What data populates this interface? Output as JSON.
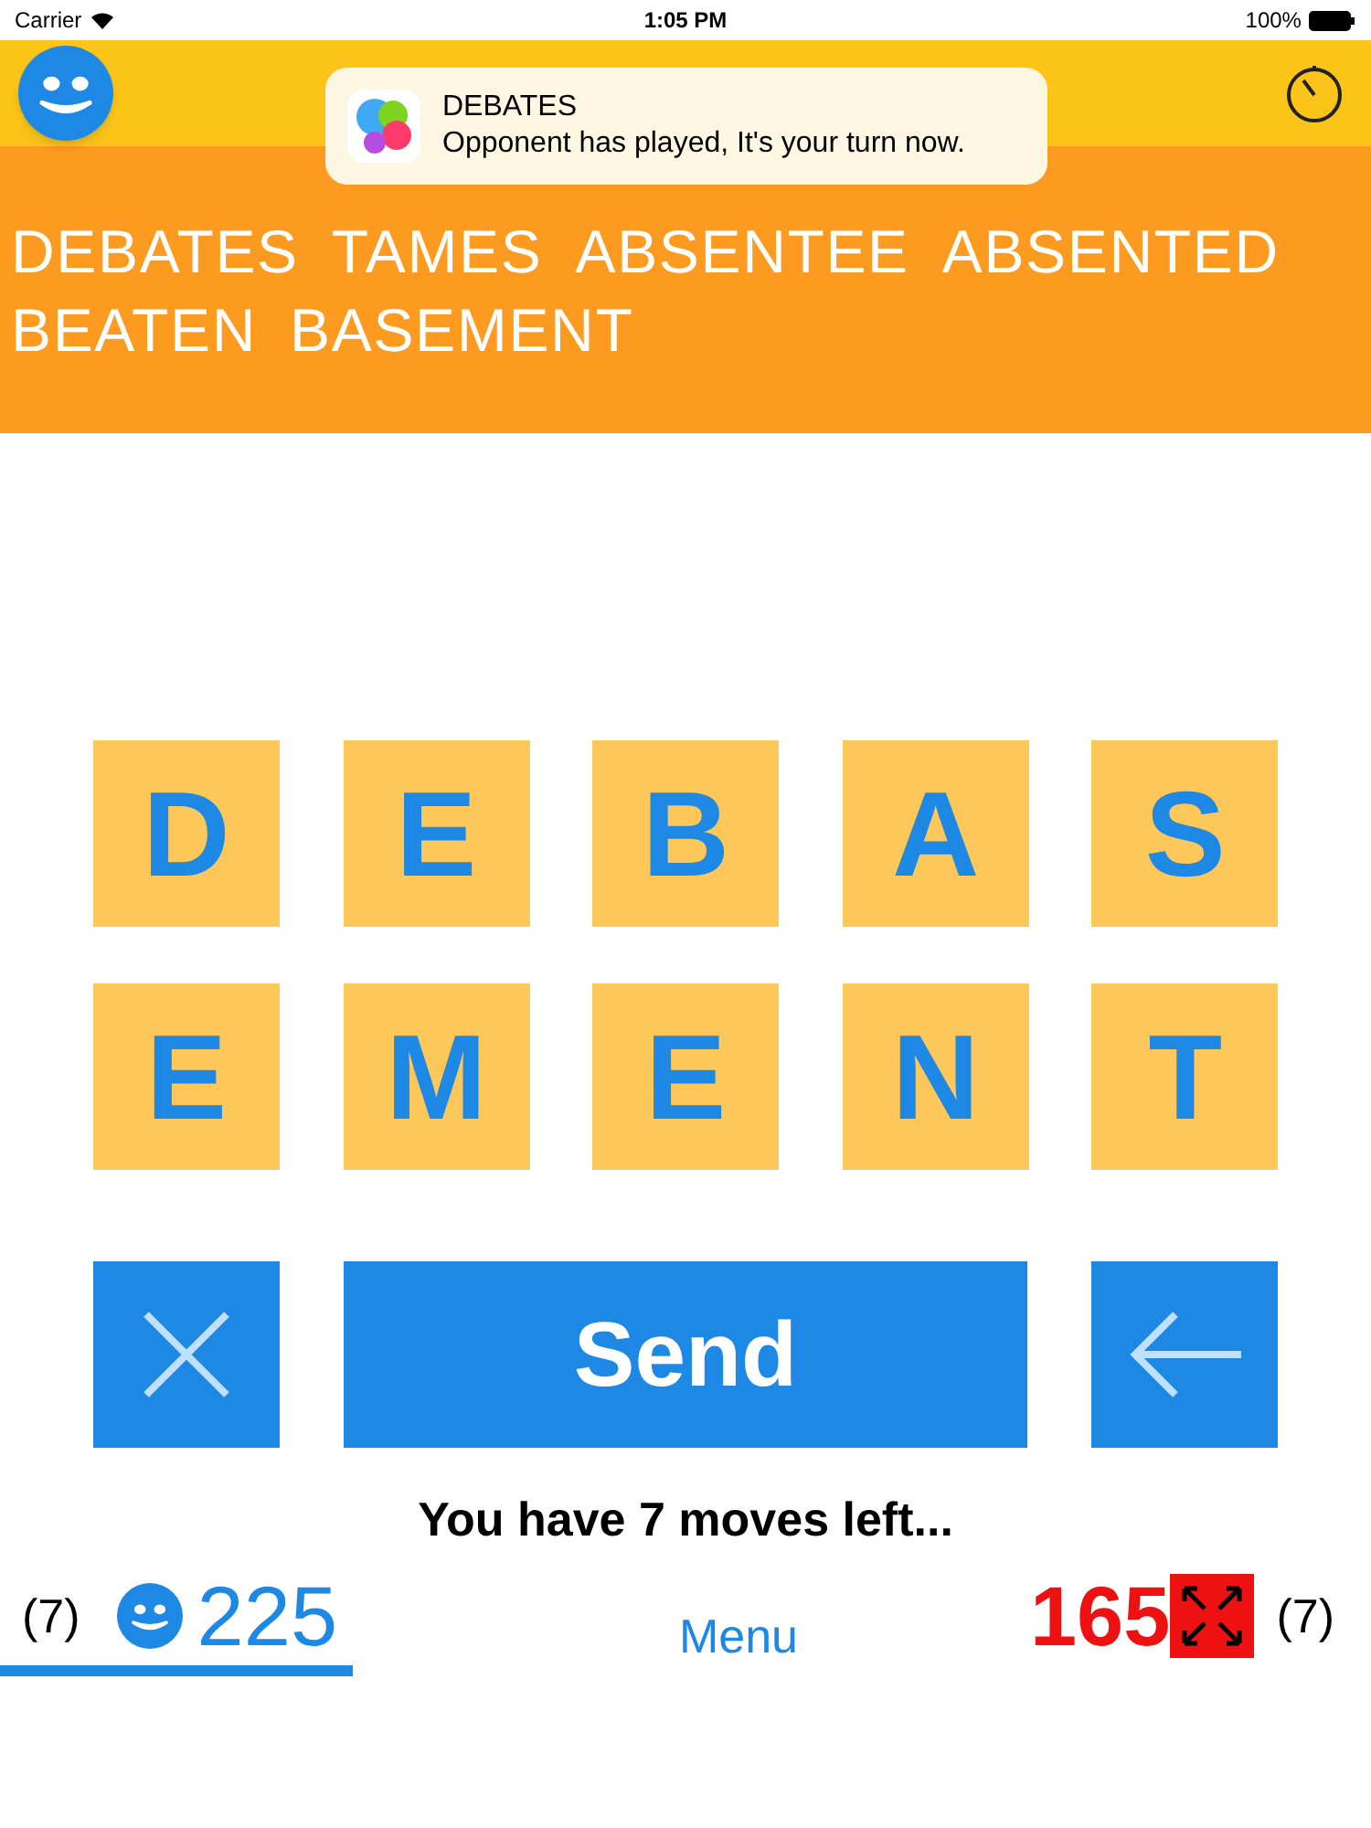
{
  "status_bar": {
    "carrier": "Carrier",
    "time": "1:05 PM",
    "battery": "100%"
  },
  "notification": {
    "app": "DEBATES",
    "message": "Opponent has played, It's your turn now."
  },
  "found_words": [
    "DEBATES",
    "TAMES",
    "ABSENTEE",
    "ABSENTED",
    "BEATEN",
    "BASEMENT"
  ],
  "tiles": [
    "D",
    "E",
    "B",
    "A",
    "S",
    "E",
    "M",
    "E",
    "N",
    "T"
  ],
  "send_button": "Send",
  "moves_text": "You have 7 moves left...",
  "players": [
    {
      "kind": "player",
      "moves": "(7)",
      "score": "225",
      "selected": true
    },
    {
      "kind": "opponent",
      "moves": "(7)",
      "score": "165",
      "selected": false
    }
  ],
  "menu": "Menu"
}
